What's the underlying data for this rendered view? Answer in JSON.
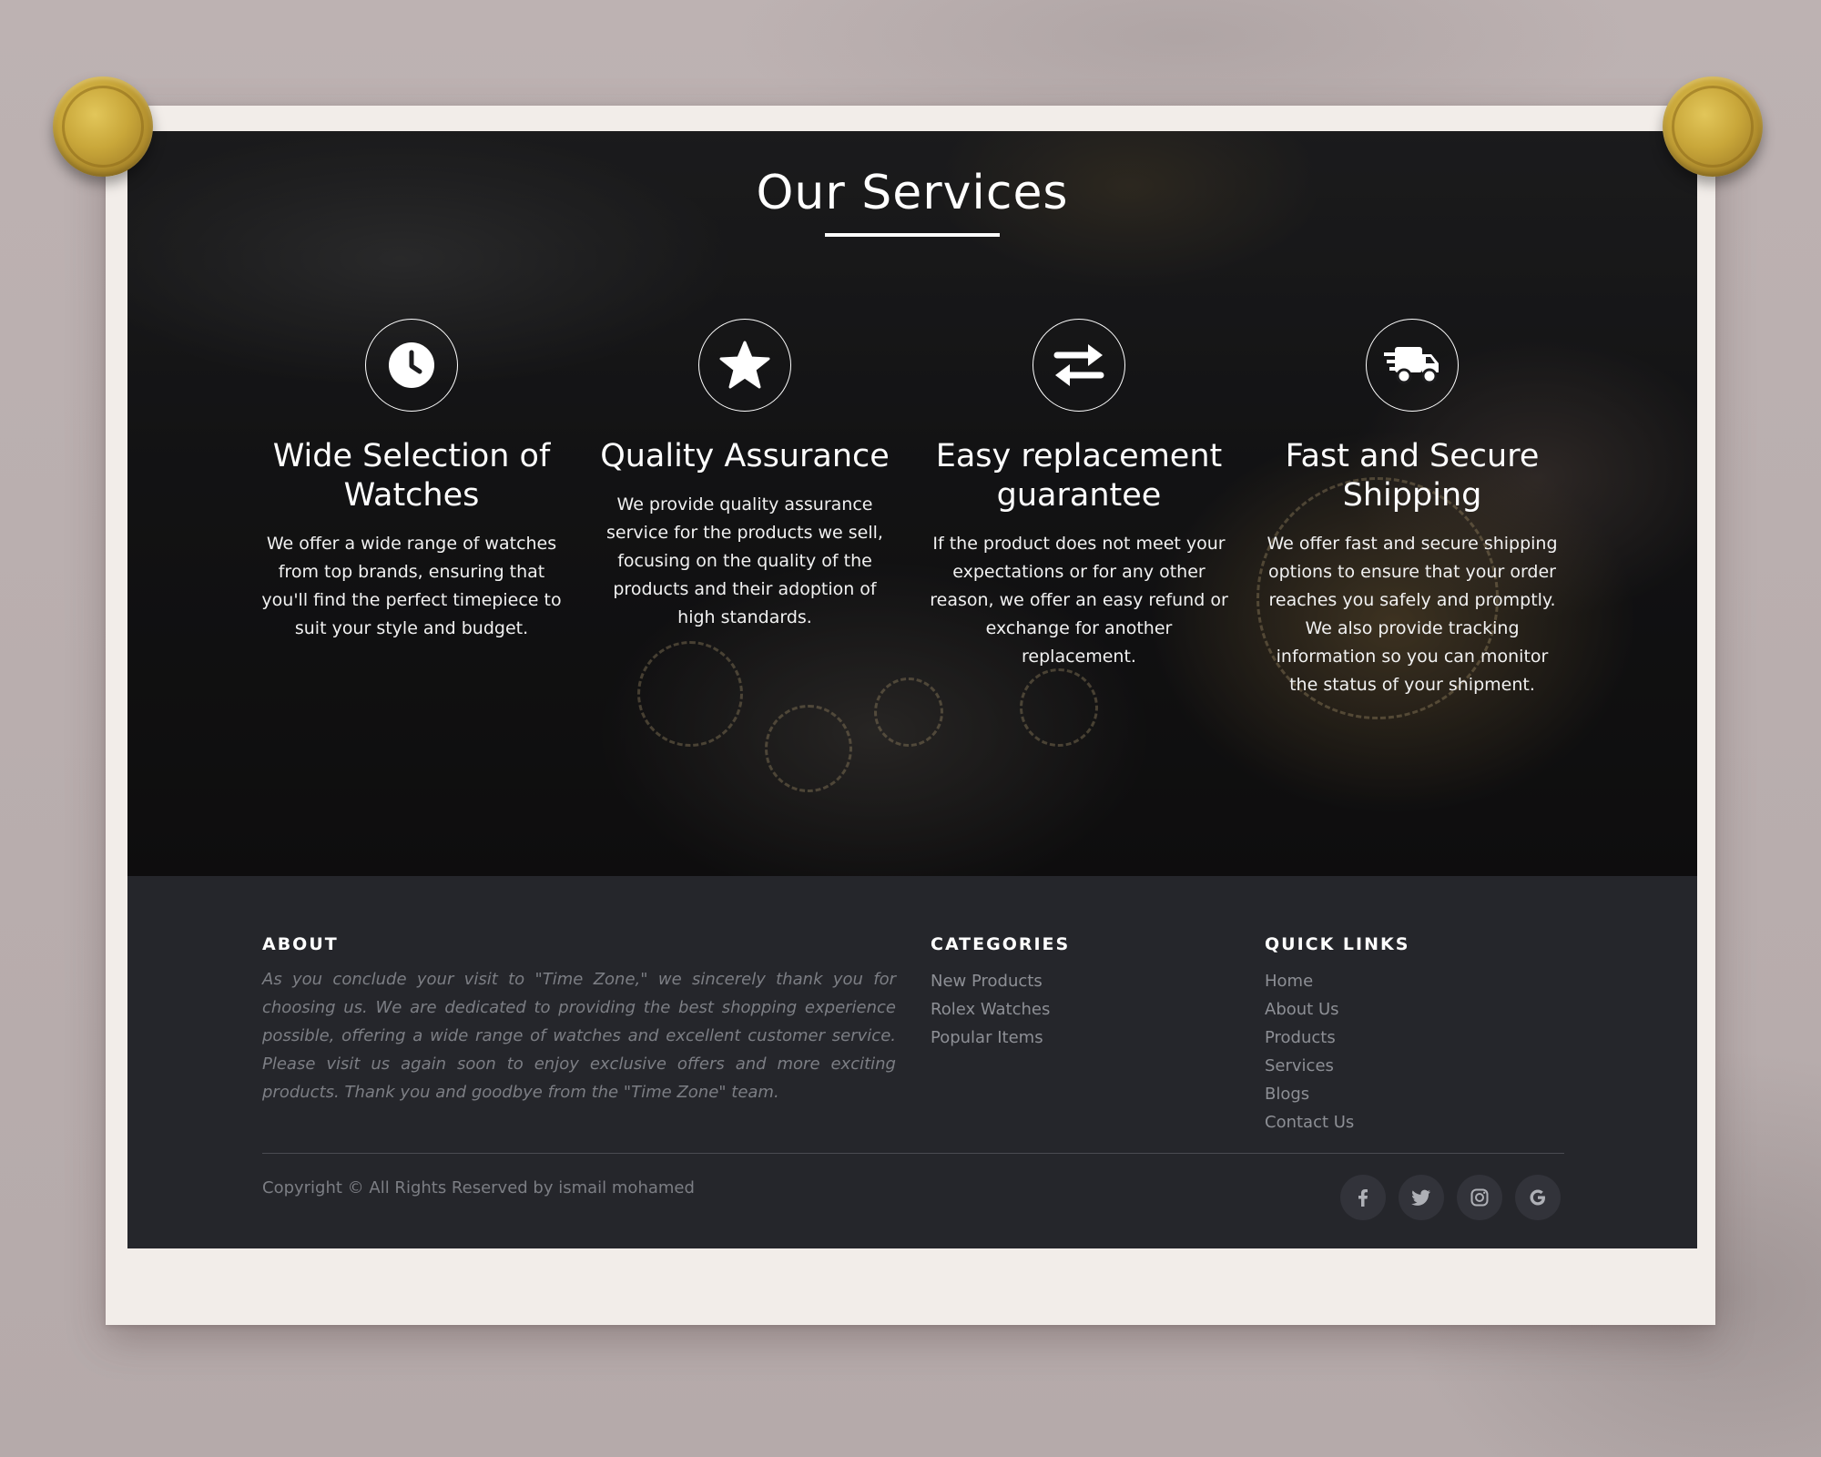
{
  "services": {
    "title": "Our Services",
    "items": [
      {
        "icon": "clock-icon",
        "heading": "Wide Selection of Watches",
        "text": "We offer a wide range of watches from top brands, ensuring that you'll find the perfect timepiece to suit your style and budget."
      },
      {
        "icon": "star-icon",
        "heading": "Quality Assurance",
        "text": "We provide quality assurance service for the products we sell, focusing on the quality of the products and their adoption of high standards."
      },
      {
        "icon": "exchange-arrows-icon",
        "heading": "Easy replacement guarantee",
        "text": "If the product does not meet your expectations or for any other reason, we offer an easy refund or exchange for another replacement."
      },
      {
        "icon": "shipping-truck-icon",
        "heading": "Fast and Secure Shipping",
        "text": "We offer fast and secure shipping options to ensure that your order reaches you safely and promptly. We also provide tracking information so you can monitor the status of your shipment."
      }
    ]
  },
  "footer": {
    "about": {
      "heading": "ABOUT",
      "text": "As you conclude your visit to \"Time Zone,\" we sincerely thank you for choosing us. We are dedicated to providing the best shopping experience possible, offering a wide range of watches and excellent customer service. Please visit us again soon to enjoy exclusive offers and more exciting products. Thank you and goodbye from the \"Time Zone\" team."
    },
    "categories": {
      "heading": "CATEGORIES",
      "links": [
        "New Products",
        "Rolex Watches",
        "Popular Items"
      ]
    },
    "quick_links": {
      "heading": "QUICK LINKS",
      "links": [
        "Home",
        "About Us",
        "Products",
        "Services",
        "Blogs",
        "Contact Us"
      ]
    },
    "copyright": "Copyright © All Rights Reserved by ismail mohamed",
    "social": [
      "facebook-icon",
      "twitter-icon",
      "instagram-icon",
      "google-icon"
    ]
  },
  "colors": {
    "backdrop": "#b9aeae",
    "paper": "#f2ede9",
    "pin_gold": "#c9a73a",
    "footer_bg": "#25262b",
    "social_bg": "#32333a"
  }
}
